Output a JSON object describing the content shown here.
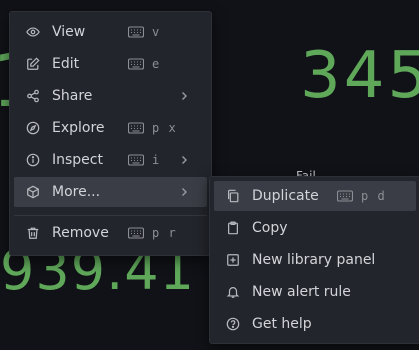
{
  "background": {
    "stat_top_left": "1",
    "stat_top_right": "345",
    "stat_bottom_left": "939.41",
    "stat_label": "Fail"
  },
  "context_menu": {
    "items": [
      {
        "label": "View",
        "icon": "eye-icon",
        "shortcut": "v",
        "submenu": false
      },
      {
        "label": "Edit",
        "icon": "edit-icon",
        "shortcut": "e",
        "submenu": false
      },
      {
        "label": "Share",
        "icon": "share-icon",
        "shortcut": "",
        "submenu": true
      },
      {
        "label": "Explore",
        "icon": "compass-icon",
        "shortcut": "p x",
        "submenu": false
      },
      {
        "label": "Inspect",
        "icon": "info-icon",
        "shortcut": "i",
        "submenu": true
      },
      {
        "label": "More...",
        "icon": "cube-icon",
        "shortcut": "",
        "submenu": true,
        "active": true
      },
      {
        "label": "Remove",
        "icon": "trash-icon",
        "shortcut": "p r",
        "submenu": false
      }
    ]
  },
  "more_submenu": {
    "items": [
      {
        "label": "Duplicate",
        "icon": "copy-icon",
        "shortcut": "p d",
        "active": true
      },
      {
        "label": "Copy",
        "icon": "clipboard-icon",
        "shortcut": ""
      },
      {
        "label": "New library panel",
        "icon": "plus-square-icon",
        "shortcut": ""
      },
      {
        "label": "New alert rule",
        "icon": "bell-icon",
        "shortcut": ""
      },
      {
        "label": "Get help",
        "icon": "question-circle-icon",
        "shortcut": ""
      }
    ]
  },
  "colors": {
    "stat_green": "#5fa85a",
    "menu_bg": "#22252b",
    "active_bg": "#3a3d45"
  }
}
